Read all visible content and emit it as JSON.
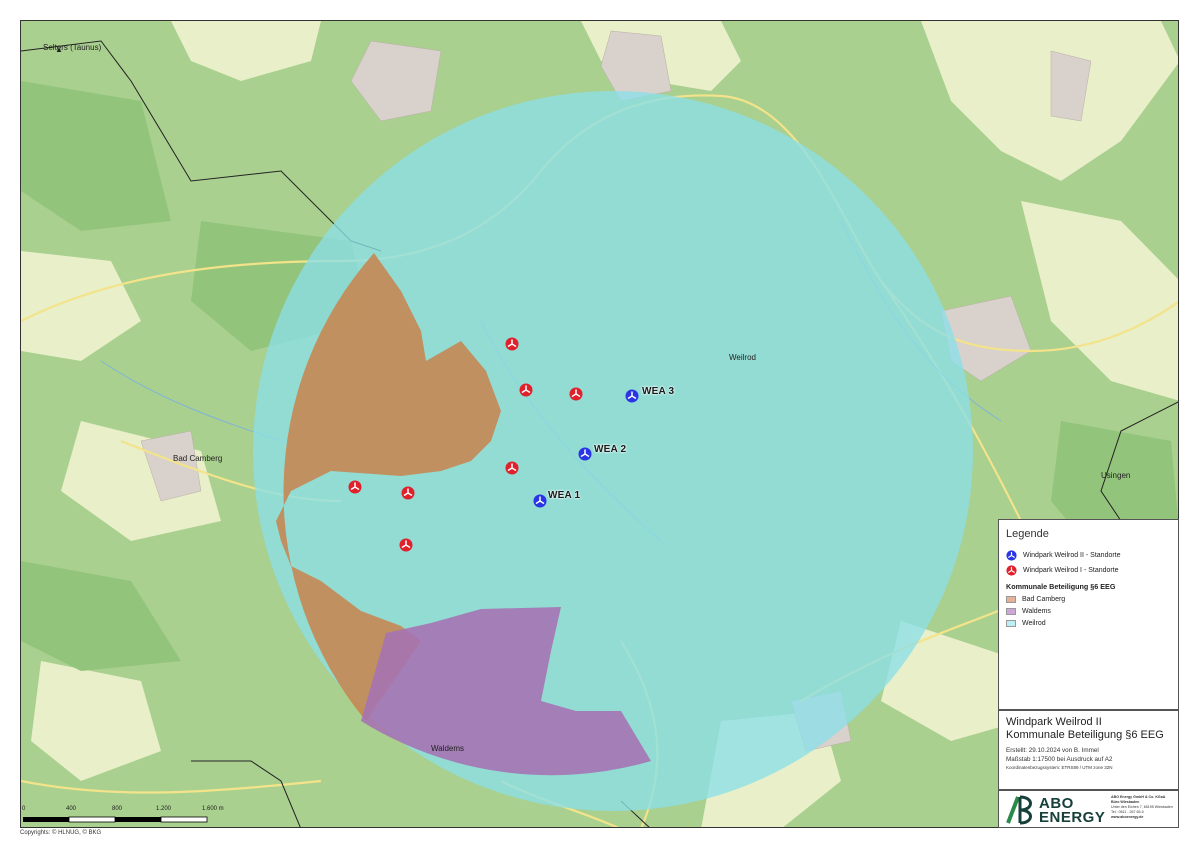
{
  "map": {
    "places": {
      "selters": "Selters (Taunus)",
      "weilrod": "Weilrod",
      "bad_camberg": "Bad Camberg",
      "usingen": "Usingen",
      "waldems": "Waldems"
    },
    "turbines_new": [
      {
        "label": "WEA 1"
      },
      {
        "label": "WEA 2"
      },
      {
        "label": "WEA 3"
      }
    ],
    "colors": {
      "base_map": "#a7cf90",
      "weilrod_zone": "#8cdfe8",
      "bad_camberg_zone": "#c9824b",
      "waldems_zone": "#a673b3",
      "turbine_new": "#2a35e6",
      "turbine_existing": "#e0202a"
    }
  },
  "legend": {
    "title": "Legende",
    "new_sites": "Windpark Weilrod II - Standorte",
    "existing_sites": "Windpark Weilrod I - Standorte",
    "section_title": "Kommunale Beteiligung §6 EEG",
    "areas": [
      "Bad Camberg",
      "Waldems",
      "Weilrod"
    ]
  },
  "title_block": {
    "line1": "Windpark Weilrod II",
    "line2": "Kommunale Beteiligung §6 EEG",
    "created": "Erstellt: 29.10.2024 von B. Immel",
    "scale": "Maßstab 1:17500   bei Ausdruck auf A2",
    "crs": "Koordinatenbezugssystem: ETRS89 / UTM zone 32N"
  },
  "logo": {
    "brand_line1": "ABO",
    "brand_line2": "ENERGY",
    "company": "ABO Energy GmbH & Co. KGaA",
    "office": "Büro Wiesbaden",
    "street": "Unter den Eichen 7, 65195 Wiesbaden",
    "tel": "Tel.: 0611 - 267 65-0",
    "web": "www.aboenergy.de"
  },
  "scale_bar": {
    "ticks": [
      "0",
      "400",
      "800",
      "1.200",
      "1.600 m"
    ]
  },
  "copyright": "Copyrights: © HLNUG, © BKG"
}
